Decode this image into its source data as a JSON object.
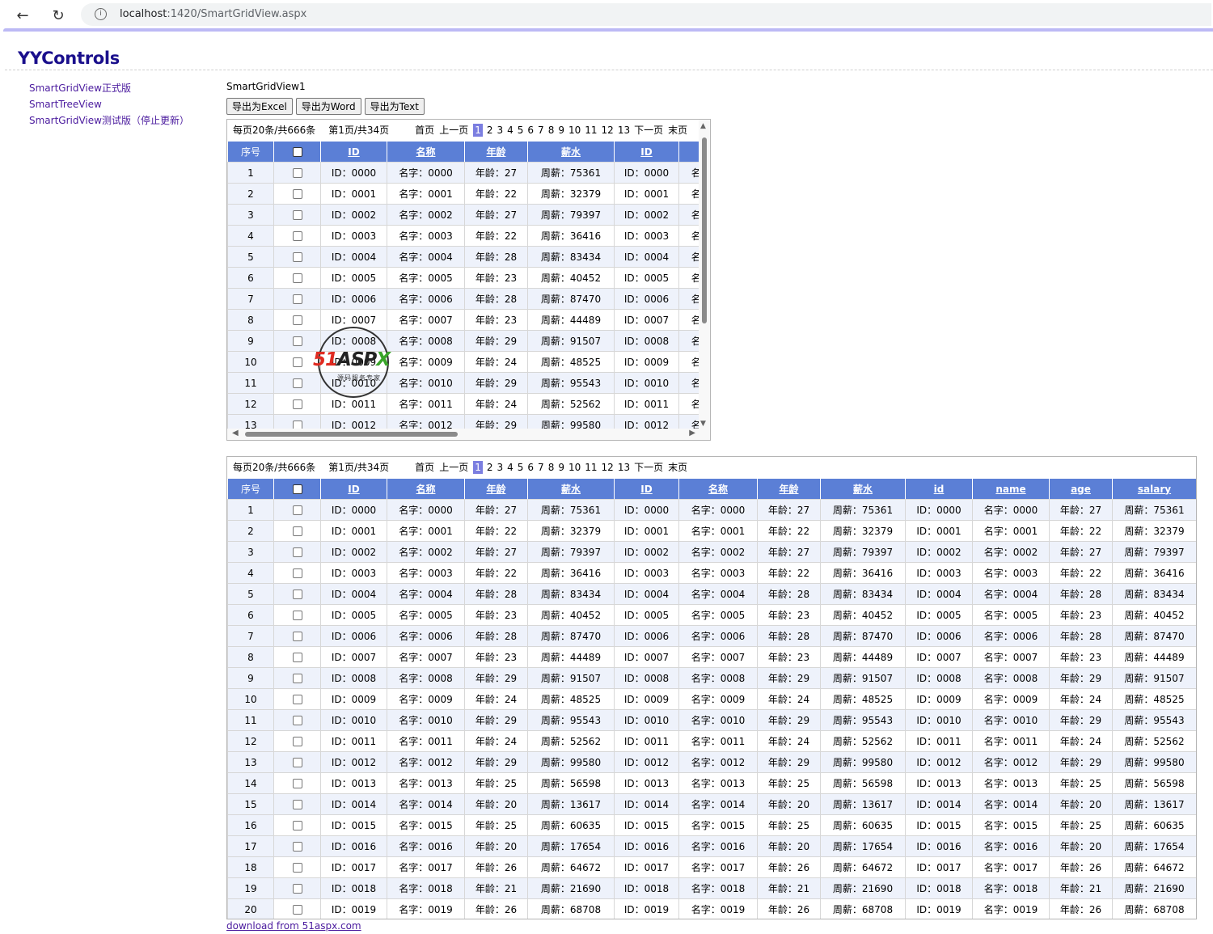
{
  "browser": {
    "url_host": "localhost",
    "url_rest": ":1420/SmartGridView.aspx"
  },
  "site": {
    "title": "YYControls"
  },
  "sidebar": {
    "items": [
      {
        "label": "SmartGridView正式版"
      },
      {
        "label": "SmartTreeView"
      },
      {
        "label": "SmartGridView测试版（停止更新）"
      }
    ]
  },
  "grid_caption": "SmartGridView1",
  "export": {
    "excel": "导出为Excel",
    "word": "导出为Word",
    "text": "导出为Text"
  },
  "pager": {
    "info": "每页20条/共666条",
    "page_info": "第1页/共34页",
    "first": "首页",
    "prev": "上一页",
    "current": "1",
    "pages": [
      "2",
      "3",
      "4",
      "5",
      "6",
      "7",
      "8",
      "9",
      "10",
      "11",
      "12",
      "13"
    ],
    "next": "下一页",
    "last": "末页"
  },
  "columns": [
    "序号",
    "",
    "ID",
    "名称",
    "年龄",
    "薪水",
    "ID",
    "名称",
    "年龄",
    "薪水",
    "id",
    "name",
    "age",
    "salary"
  ],
  "rows": [
    {
      "n": "1",
      "id": "ID：0000",
      "name": "名字：0000",
      "age": "年龄：27",
      "sal": "周薪：75361"
    },
    {
      "n": "2",
      "id": "ID：0001",
      "name": "名字：0001",
      "age": "年龄：22",
      "sal": "周薪：32379"
    },
    {
      "n": "3",
      "id": "ID：0002",
      "name": "名字：0002",
      "age": "年龄：27",
      "sal": "周薪：79397"
    },
    {
      "n": "4",
      "id": "ID：0003",
      "name": "名字：0003",
      "age": "年龄：22",
      "sal": "周薪：36416"
    },
    {
      "n": "5",
      "id": "ID：0004",
      "name": "名字：0004",
      "age": "年龄：28",
      "sal": "周薪：83434"
    },
    {
      "n": "6",
      "id": "ID：0005",
      "name": "名字：0005",
      "age": "年龄：23",
      "sal": "周薪：40452"
    },
    {
      "n": "7",
      "id": "ID：0006",
      "name": "名字：0006",
      "age": "年龄：28",
      "sal": "周薪：87470"
    },
    {
      "n": "8",
      "id": "ID：0007",
      "name": "名字：0007",
      "age": "年龄：23",
      "sal": "周薪：44489"
    },
    {
      "n": "9",
      "id": "ID：0008",
      "name": "名字：0008",
      "age": "年龄：29",
      "sal": "周薪：91507"
    },
    {
      "n": "10",
      "id": "ID：0009",
      "name": "名字：0009",
      "age": "年龄：24",
      "sal": "周薪：48525"
    },
    {
      "n": "11",
      "id": "ID：0010",
      "name": "名字：0010",
      "age": "年龄：29",
      "sal": "周薪：95543"
    },
    {
      "n": "12",
      "id": "ID：0011",
      "name": "名字：0011",
      "age": "年龄：24",
      "sal": "周薪：52562"
    },
    {
      "n": "13",
      "id": "ID：0012",
      "name": "名字：0012",
      "age": "年龄：29",
      "sal": "周薪：99580"
    },
    {
      "n": "14",
      "id": "ID：0013",
      "name": "名字：0013",
      "age": "年龄：25",
      "sal": "周薪：56598"
    },
    {
      "n": "15",
      "id": "ID：0014",
      "name": "名字：0014",
      "age": "年龄：20",
      "sal": "周薪：13617"
    },
    {
      "n": "16",
      "id": "ID：0015",
      "name": "名字：0015",
      "age": "年龄：25",
      "sal": "周薪：60635"
    },
    {
      "n": "17",
      "id": "ID：0016",
      "name": "名字：0016",
      "age": "年龄：20",
      "sal": "周薪：17654"
    },
    {
      "n": "18",
      "id": "ID：0017",
      "name": "名字：0017",
      "age": "年龄：26",
      "sal": "周薪：64672"
    },
    {
      "n": "19",
      "id": "ID：0018",
      "name": "名字：0018",
      "age": "年龄：21",
      "sal": "周薪：21690"
    },
    {
      "n": "20",
      "id": "ID：0019",
      "name": "名字：0019",
      "age": "年龄：26",
      "sal": "周薪：68708"
    }
  ],
  "footer": {
    "link": "download from 51aspx.com"
  },
  "watermark": {
    "logo_a": "51",
    "logo_b": "ASP",
    "logo_c": "X",
    "sub": "源码服务专家"
  },
  "colors": {
    "header": "#5b7fd6",
    "alt_row": "#eef2fb",
    "pager_current": "#7b7ee0",
    "link": "#4a1a9e"
  }
}
